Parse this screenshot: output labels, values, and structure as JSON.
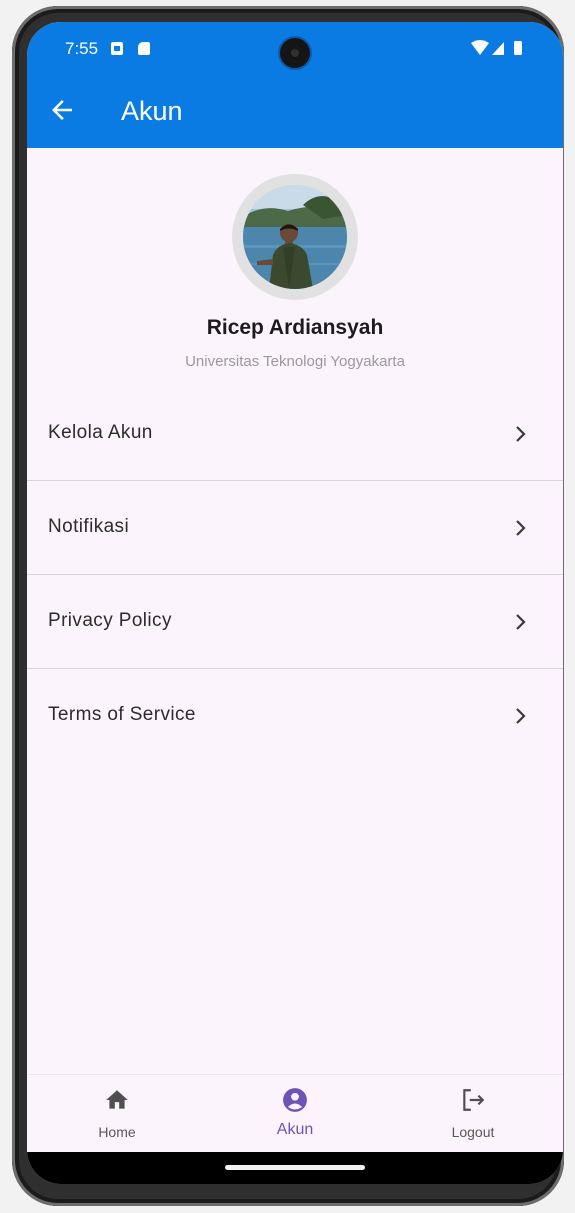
{
  "status_bar": {
    "time": "7:55"
  },
  "app_bar": {
    "title": "Akun"
  },
  "profile": {
    "name": "Ricep Ardiansyah",
    "institution": "Universitas Teknologi Yogyakarta"
  },
  "menu": [
    {
      "label": "Kelola Akun"
    },
    {
      "label": "Notifikasi"
    },
    {
      "label": "Privacy Policy"
    },
    {
      "label": "Terms of Service"
    }
  ],
  "bottom_nav": {
    "home_label": "Home",
    "akun_label": "Akun",
    "logout_label": "Logout",
    "active": "Akun"
  },
  "colors": {
    "app_bar": "#0a7be3",
    "background": "#fcf4fc",
    "active_nav": "#6f52b5"
  },
  "icons": [
    "arrow-back-icon",
    "chevron-right-icon",
    "home-icon",
    "account-circle-icon",
    "logout-icon",
    "wifi-icon",
    "signal-icon",
    "battery-icon"
  ]
}
